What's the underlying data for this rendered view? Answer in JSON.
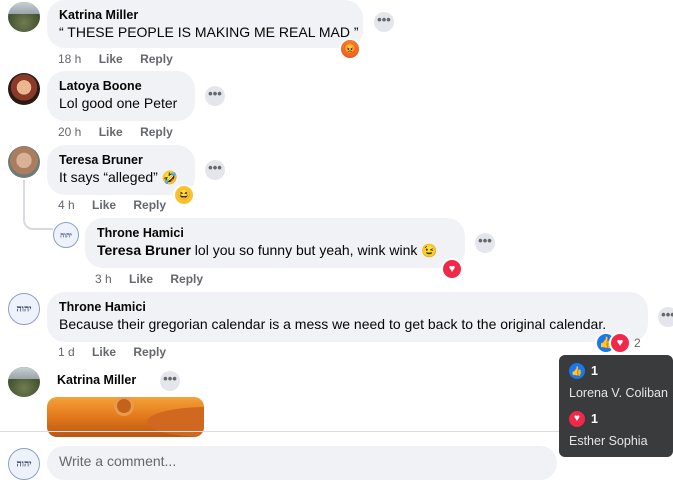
{
  "comments": [
    {
      "author": "Katrina Miller",
      "text": "“ THESE PEOPLE IS MAKING ME REAL MAD ”",
      "time": "18 h",
      "like": "Like",
      "reply": "Reply"
    },
    {
      "author": "Latoya Boone",
      "text": "Lol good one Peter",
      "time": "20 h",
      "like": "Like",
      "reply": "Reply"
    },
    {
      "author": "Teresa Bruner",
      "text": "It says “alleged”",
      "emoji": "🤣",
      "time": "4 h",
      "like": "Like",
      "reply": "Reply"
    },
    {
      "author": "Throne Hamici",
      "mention": "Teresa Bruner",
      "text": " lol you so funny but yeah, wink wink",
      "emoji": "😉",
      "time": "3 h",
      "like": "Like",
      "reply": "Reply"
    },
    {
      "author": "Throne Hamici",
      "text": "Because their gregorian calendar is a mess we need to get back to the original calendar.",
      "time": "1 d",
      "like": "Like",
      "reply": "Reply",
      "reaction_count": "2"
    },
    {
      "author": "Katrina Miller"
    }
  ],
  "dots": "•••",
  "avatar_glyph": "יהוה",
  "tooltip": {
    "rows": [
      {
        "icon": "like-icon",
        "count": "1",
        "name": "Lorena V. Coliban"
      },
      {
        "icon": "love-icon",
        "count": "1",
        "name": "Esther Sophia"
      }
    ]
  },
  "write_placeholder": "Write a comment...",
  "colors": {
    "like": "#1877f2",
    "love": "#f02849",
    "meta": "#65676b",
    "bubble": "#f0f2f5"
  }
}
